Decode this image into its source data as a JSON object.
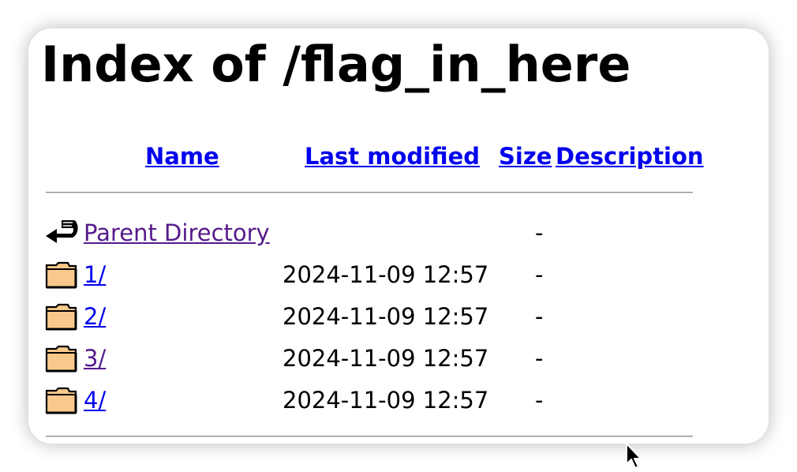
{
  "page": {
    "title": "Index of /flag_in_here"
  },
  "columns": {
    "name": "Name",
    "last_modified": "Last modified",
    "size": "Size",
    "description": "Description"
  },
  "rows": [
    {
      "icon": "back-arrow-icon",
      "name": "Parent Directory",
      "last_modified": "",
      "size": "-",
      "visited": true
    },
    {
      "icon": "folder-icon",
      "name": "1/",
      "last_modified": "2024-11-09 12:57",
      "size": "-",
      "visited": false
    },
    {
      "icon": "folder-icon",
      "name": "2/",
      "last_modified": "2024-11-09 12:57",
      "size": "-",
      "visited": false
    },
    {
      "icon": "folder-icon",
      "name": "3/",
      "last_modified": "2024-11-09 12:57",
      "size": "-",
      "visited": true
    },
    {
      "icon": "folder-icon",
      "name": "4/",
      "last_modified": "2024-11-09 12:57",
      "size": "-",
      "visited": false
    }
  ],
  "colors": {
    "link": "#0000ee",
    "visited_link": "#551a8b",
    "folder_fill": "#f8c98a"
  }
}
